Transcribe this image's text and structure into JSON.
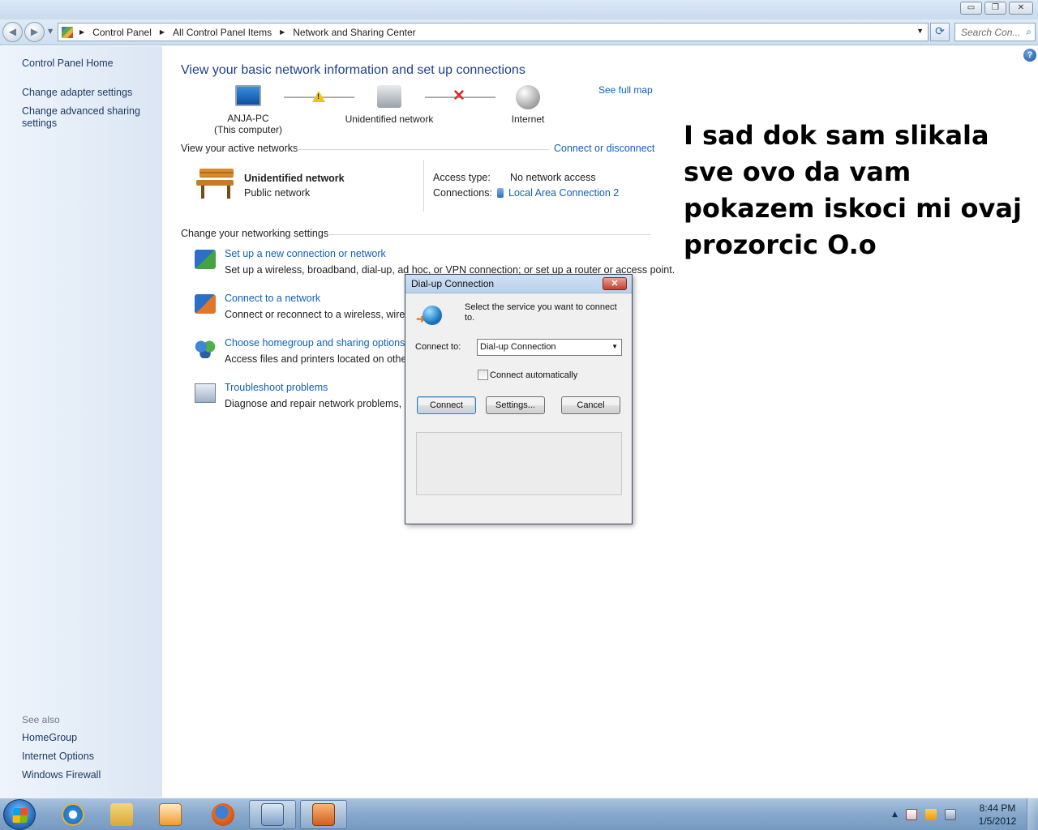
{
  "window": {
    "minimize_label": "▭",
    "restore_label": "❐",
    "close_label": "✕"
  },
  "address": {
    "crumbs": [
      "Control Panel",
      "All Control Panel Items",
      "Network and Sharing Center"
    ],
    "search_placeholder": "Search Con..."
  },
  "sidebar": {
    "home": "Control Panel Home",
    "adapter": "Change adapter settings",
    "advanced_line1": "Change advanced sharing",
    "advanced_line2": "settings",
    "see_also": "See also",
    "homegroup": "HomeGroup",
    "internet_options": "Internet Options",
    "firewall": "Windows Firewall"
  },
  "main": {
    "title": "View your basic network information and set up connections",
    "see_full_map": "See full map",
    "map": {
      "computer_name": "ANJA-PC",
      "computer_sub": "(This computer)",
      "network": "Unidentified network",
      "internet": "Internet"
    },
    "active_networks_heading": "View your active networks",
    "connect_disconnect": "Connect or disconnect",
    "network_name": "Unidentified network",
    "network_type": "Public network",
    "access_type_label": "Access type:",
    "access_type_value": "No network access",
    "connections_label": "Connections:",
    "connections_value": "Local Area Connection 2",
    "settings_heading": "Change your networking settings",
    "tasks": [
      {
        "title": "Set up a new connection or network",
        "desc": "Set up a wireless, broadband, dial-up, ad hoc, or VPN connection; or set up a router or access point."
      },
      {
        "title": "Connect to a network",
        "desc": "Connect or reconnect to a wireless, wired,"
      },
      {
        "title": "Choose homegroup and sharing options",
        "desc": "Access files and printers located on other n"
      },
      {
        "title": "Troubleshoot problems",
        "desc": "Diagnose and repair network problems, or"
      }
    ]
  },
  "overlay_text": "I sad dok sam slikala sve ovo da vam pokazem iskoci mi ovaj prozorcic O.o",
  "dialog": {
    "title": "Dial-up Connection",
    "prompt": "Select the service you want to connect to.",
    "connect_to_label": "Connect to:",
    "connect_to_value": "Dial-up Connection",
    "auto_connect_label": "Connect automatically",
    "auto_connect_checked": false,
    "connect_button": "Connect",
    "settings_button": "Settings...",
    "cancel_button": "Cancel"
  },
  "taskbar": {
    "time": "8:44 PM",
    "date": "1/5/2012"
  }
}
